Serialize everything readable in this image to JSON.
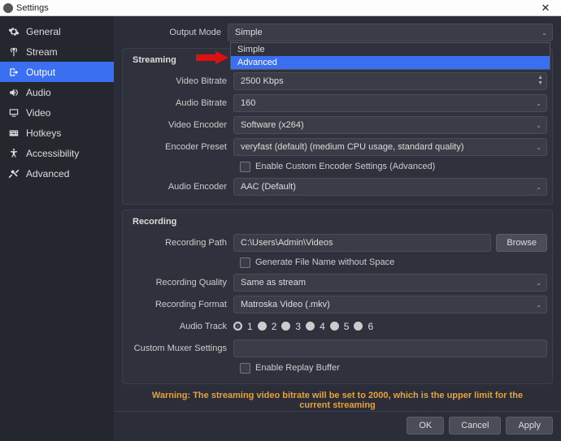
{
  "window": {
    "title": "Settings"
  },
  "sidebar": {
    "items": [
      {
        "label": "General"
      },
      {
        "label": "Stream"
      },
      {
        "label": "Output"
      },
      {
        "label": "Audio"
      },
      {
        "label": "Video"
      },
      {
        "label": "Hotkeys"
      },
      {
        "label": "Accessibility"
      },
      {
        "label": "Advanced"
      }
    ]
  },
  "output_mode": {
    "label": "Output Mode",
    "value": "Simple",
    "options": [
      "Simple",
      "Advanced"
    ]
  },
  "streaming": {
    "title": "Streaming",
    "video_bitrate": {
      "label": "Video Bitrate",
      "value": "2500 Kbps"
    },
    "audio_bitrate": {
      "label": "Audio Bitrate",
      "value": "160"
    },
    "video_encoder": {
      "label": "Video Encoder",
      "value": "Software (x264)"
    },
    "encoder_preset": {
      "label": "Encoder Preset",
      "value": "veryfast (default) (medium CPU usage, standard quality)"
    },
    "enable_custom": "Enable Custom Encoder Settings (Advanced)",
    "audio_encoder": {
      "label": "Audio Encoder",
      "value": "AAC (Default)"
    }
  },
  "recording": {
    "title": "Recording",
    "path": {
      "label": "Recording Path",
      "value": "C:\\Users\\Admin\\Videos",
      "browse": "Browse"
    },
    "gen_filename": "Generate File Name without Space",
    "quality": {
      "label": "Recording Quality",
      "value": "Same as stream"
    },
    "format": {
      "label": "Recording Format",
      "value": "Matroska Video (.mkv)"
    },
    "audio_track": {
      "label": "Audio Track",
      "tracks": [
        "1",
        "2",
        "3",
        "4",
        "5",
        "6"
      ]
    },
    "muxer": {
      "label": "Custom Muxer Settings",
      "value": ""
    },
    "replay_buffer": "Enable Replay Buffer"
  },
  "warning": "Warning: The streaming video bitrate will be set to 2000, which is the upper limit for the current streaming",
  "footer": {
    "ok": "OK",
    "cancel": "Cancel",
    "apply": "Apply"
  }
}
